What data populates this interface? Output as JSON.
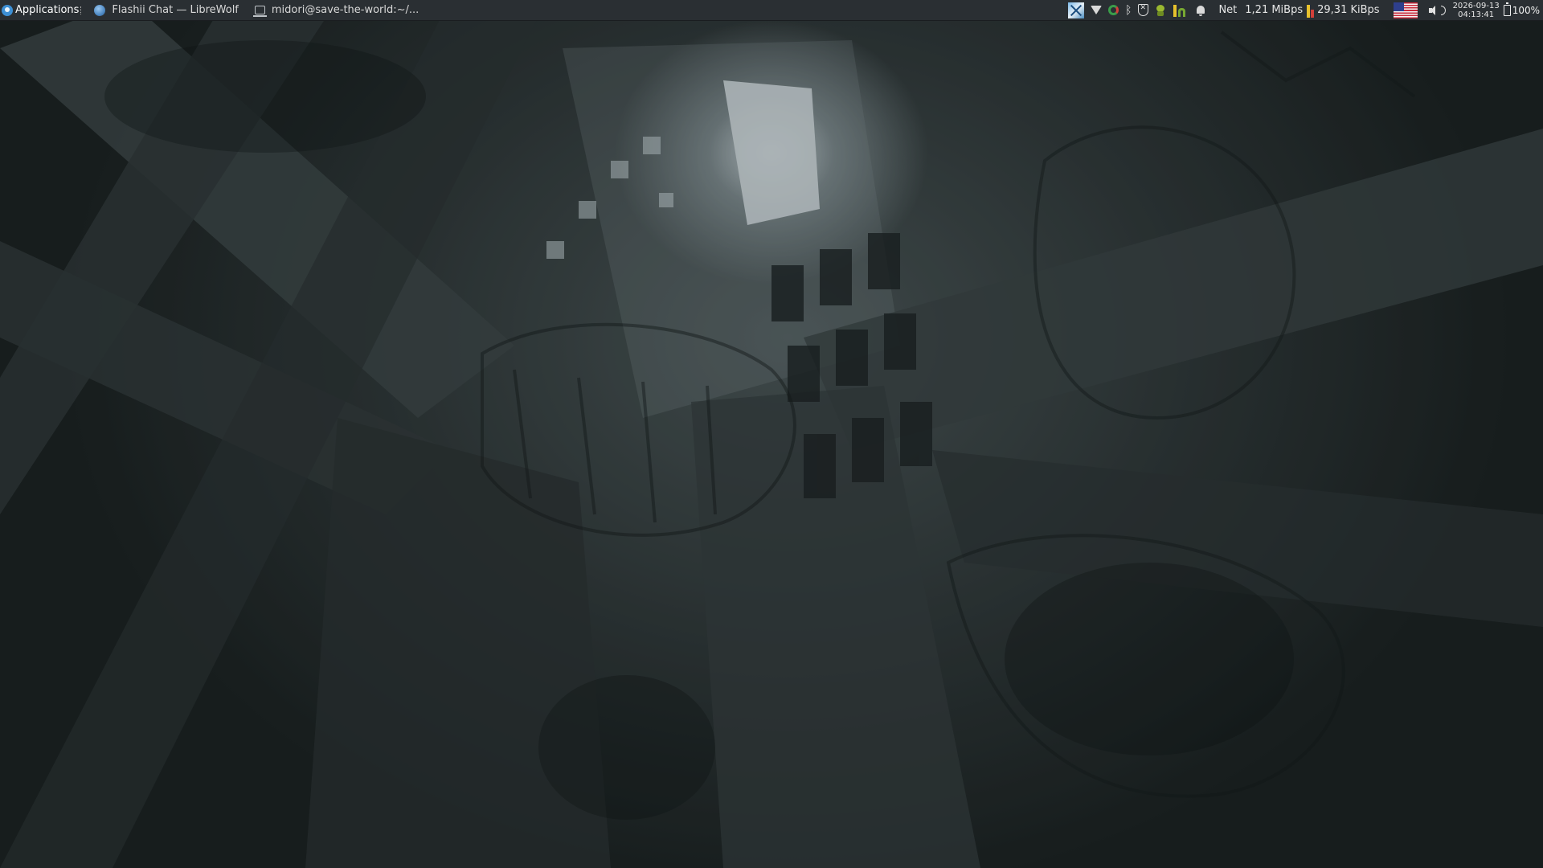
{
  "panel": {
    "applications_label": "Applications",
    "tasks": [
      {
        "title": "Flashii Chat — LibreWolf",
        "icon": "librewolf-globe-icon"
      },
      {
        "title": "midori@save-the-world:~/...",
        "icon": "terminal-icon"
      }
    ],
    "tray": {
      "net_label": "Net",
      "net_down": "1,21 MiBps",
      "net_up": "29,31 KiBps",
      "net_bar_colors": [
        "#e8c12c",
        "#d2403a"
      ],
      "clock_date": "2026-09-13",
      "clock_time": "04:13:41",
      "battery_percent": "100%"
    }
  },
  "colors": {
    "panel_bg": "#2a2f33",
    "accent": "#3d8fd4"
  }
}
